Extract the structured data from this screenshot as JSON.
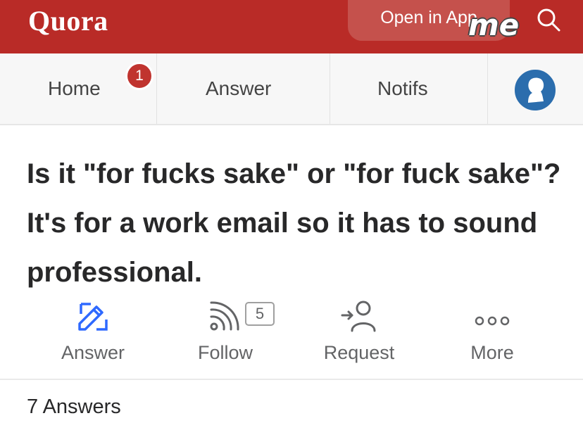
{
  "header": {
    "logo": "Quora",
    "open_app_label": "Open in App",
    "watermark": "me",
    "search_icon": "search-icon",
    "bar_color": "#b92b27"
  },
  "nav": {
    "items": [
      {
        "label": "Home"
      },
      {
        "label": "Answer"
      },
      {
        "label": "Notifs"
      }
    ],
    "home_badge": "1",
    "avatar_icon": "avatar-icon"
  },
  "question": {
    "text": "Is it \"for fucks sake\" or \"for fuck sake\"? It's for a work email so it has to sound professional."
  },
  "actions": [
    {
      "label": "Answer",
      "icon": "pencil-icon"
    },
    {
      "label": "Follow",
      "icon": "rss-icon",
      "count": "5"
    },
    {
      "label": "Request",
      "icon": "request-user-icon"
    },
    {
      "label": "More",
      "icon": "more-dots-icon"
    }
  ],
  "answers": {
    "count_label": "7 Answers"
  }
}
